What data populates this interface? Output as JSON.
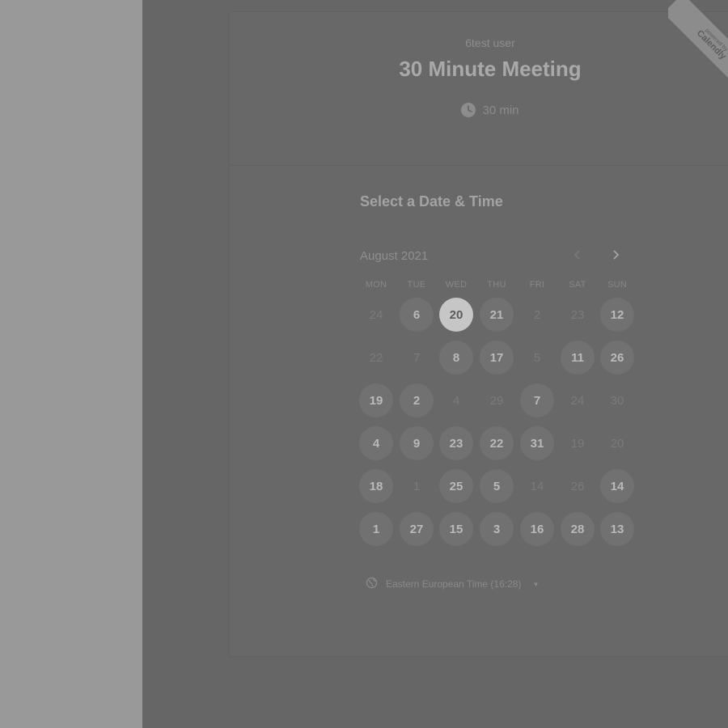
{
  "event": {
    "host": "6test user",
    "title": "30 Minute Meeting",
    "duration": "30 min",
    "duration_icon": "clock-icon"
  },
  "calendar": {
    "section_title": "Select a Date & Time",
    "month_label": "August 2021",
    "weekdays": [
      "MON",
      "TUE",
      "WED",
      "THU",
      "FRI",
      "SAT",
      "SUN"
    ],
    "weeks": [
      [
        {
          "d": "24",
          "s": "unavail"
        },
        {
          "d": "6",
          "s": "avail"
        },
        {
          "d": "20",
          "s": "selected"
        },
        {
          "d": "21",
          "s": "avail"
        },
        {
          "d": "2",
          "s": "unavail"
        },
        {
          "d": "23",
          "s": "unavail"
        },
        {
          "d": "12",
          "s": "avail"
        }
      ],
      [
        {
          "d": "22",
          "s": "unavail"
        },
        {
          "d": "7",
          "s": "unavail"
        },
        {
          "d": "8",
          "s": "avail"
        },
        {
          "d": "17",
          "s": "avail"
        },
        {
          "d": "5",
          "s": "unavail"
        },
        {
          "d": "11",
          "s": "avail"
        },
        {
          "d": "26",
          "s": "avail"
        }
      ],
      [
        {
          "d": "19",
          "s": "avail"
        },
        {
          "d": "2",
          "s": "avail"
        },
        {
          "d": "4",
          "s": "unavail"
        },
        {
          "d": "29",
          "s": "unavail"
        },
        {
          "d": "7",
          "s": "avail"
        },
        {
          "d": "24",
          "s": "unavail"
        },
        {
          "d": "30",
          "s": "unavail"
        }
      ],
      [
        {
          "d": "4",
          "s": "avail"
        },
        {
          "d": "9",
          "s": "avail"
        },
        {
          "d": "23",
          "s": "avail"
        },
        {
          "d": "22",
          "s": "avail"
        },
        {
          "d": "31",
          "s": "avail"
        },
        {
          "d": "19",
          "s": "unavail"
        },
        {
          "d": "20",
          "s": "unavail"
        }
      ],
      [
        {
          "d": "18",
          "s": "avail"
        },
        {
          "d": "1",
          "s": "unavail"
        },
        {
          "d": "25",
          "s": "avail"
        },
        {
          "d": "5",
          "s": "avail"
        },
        {
          "d": "14",
          "s": "unavail"
        },
        {
          "d": "26",
          "s": "unavail"
        },
        {
          "d": "14",
          "s": "avail"
        }
      ],
      [
        {
          "d": "1",
          "s": "avail"
        },
        {
          "d": "27",
          "s": "avail"
        },
        {
          "d": "15",
          "s": "avail"
        },
        {
          "d": "3",
          "s": "avail"
        },
        {
          "d": "16",
          "s": "avail"
        },
        {
          "d": "28",
          "s": "avail"
        },
        {
          "d": "13",
          "s": "avail"
        }
      ]
    ],
    "timezone": "Eastern European Time (16:28)"
  },
  "badge": {
    "line1": "powered by",
    "line2": "Calendly"
  },
  "colors": {
    "overlay": "#666666",
    "selected_day": "#c6c6c6",
    "available_day": "#717171"
  }
}
